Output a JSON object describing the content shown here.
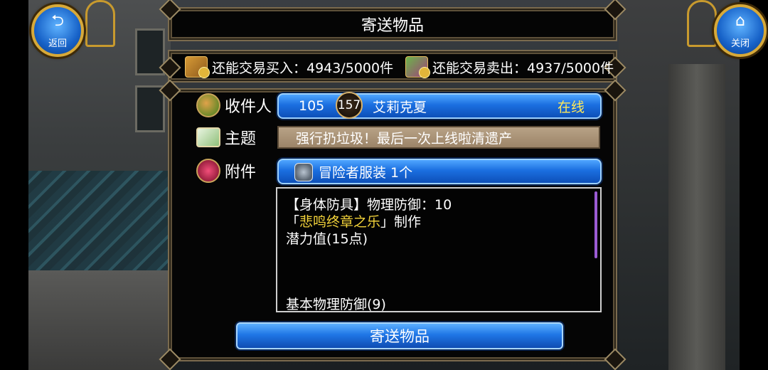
{
  "header": {
    "title": "寄送物品",
    "back_label": "返回",
    "close_label": "关闭"
  },
  "trade": {
    "buy_label": "还能交易买入：4943/5000件",
    "sell_label": "还能交易卖出：4937/5000件"
  },
  "recipient": {
    "label": "收件人",
    "level": "105",
    "badge": "157",
    "name": "艾莉克夏",
    "status": "在线"
  },
  "subject": {
    "label": "主题",
    "value": "强行扔垃圾！最后一次上线啦清遗产"
  },
  "attachment": {
    "label": "附件",
    "item": "冒险者服装  1个"
  },
  "description": {
    "line1": "【身体防具】物理防御：10",
    "line2_open": "「",
    "line2_gold": "悲鸣终章之乐",
    "line2_close": "」制作",
    "line3": "潜力值(15点)",
    "line4": "基本物理防御(9)"
  },
  "send_button_label": "寄送物品",
  "colors": {
    "button_blue": "#1b6fe0",
    "frame_gold": "#d7a939",
    "status_yellow": "#ffe95a",
    "maker_gold": "#f2d23a"
  },
  "icons": [
    "back-arrow-icon",
    "home-icon",
    "treasure-chest-icon",
    "merchant-stall-icon",
    "people-icon",
    "mail-icon",
    "gift-icon",
    "armor-icon"
  ]
}
